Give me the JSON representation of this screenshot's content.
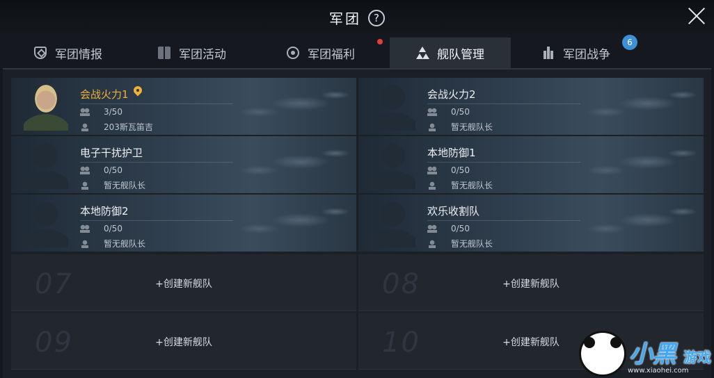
{
  "header": {
    "title": "军团",
    "help": "?"
  },
  "tabs": [
    {
      "label": "军团情报",
      "icon": "shield-icon"
    },
    {
      "label": "军团活动",
      "icon": "book-icon"
    },
    {
      "label": "军团福利",
      "icon": "gift-icon",
      "dot": true
    },
    {
      "label": "舰队管理",
      "icon": "fleet-icon",
      "active": true
    },
    {
      "label": "军团战争",
      "icon": "war-icon",
      "badge": "6"
    }
  ],
  "fleets": [
    {
      "name": "会战火力1",
      "members": "3/50",
      "leader": "203斯瓦笛吉",
      "is_own": true
    },
    {
      "name": "会战火力2",
      "members": "0/50",
      "leader": "暂无舰队长"
    },
    {
      "name": "电子干扰护卫",
      "members": "0/50",
      "leader": "暂无舰队长"
    },
    {
      "name": "本地防御1",
      "members": "0/50",
      "leader": "暂无舰队长"
    },
    {
      "name": "本地防御2",
      "members": "0/50",
      "leader": "暂无舰队长"
    },
    {
      "name": "欢乐收割队",
      "members": "0/50",
      "leader": "暂无舰队长"
    }
  ],
  "empty_slots": [
    {
      "number": "07",
      "label": "+创建新舰队"
    },
    {
      "number": "08",
      "label": "+创建新舰队"
    },
    {
      "number": "09",
      "label": "+创建新舰队"
    },
    {
      "number": "10",
      "label": "+创建新舰队"
    }
  ],
  "watermark": {
    "text": "小黑",
    "sub": "游戏",
    "url": "www.xiaohei.com"
  },
  "colors": {
    "accent_gold": "#f0b13a",
    "badge_blue": "#3d8fd6",
    "alert_red": "#e0403a"
  }
}
